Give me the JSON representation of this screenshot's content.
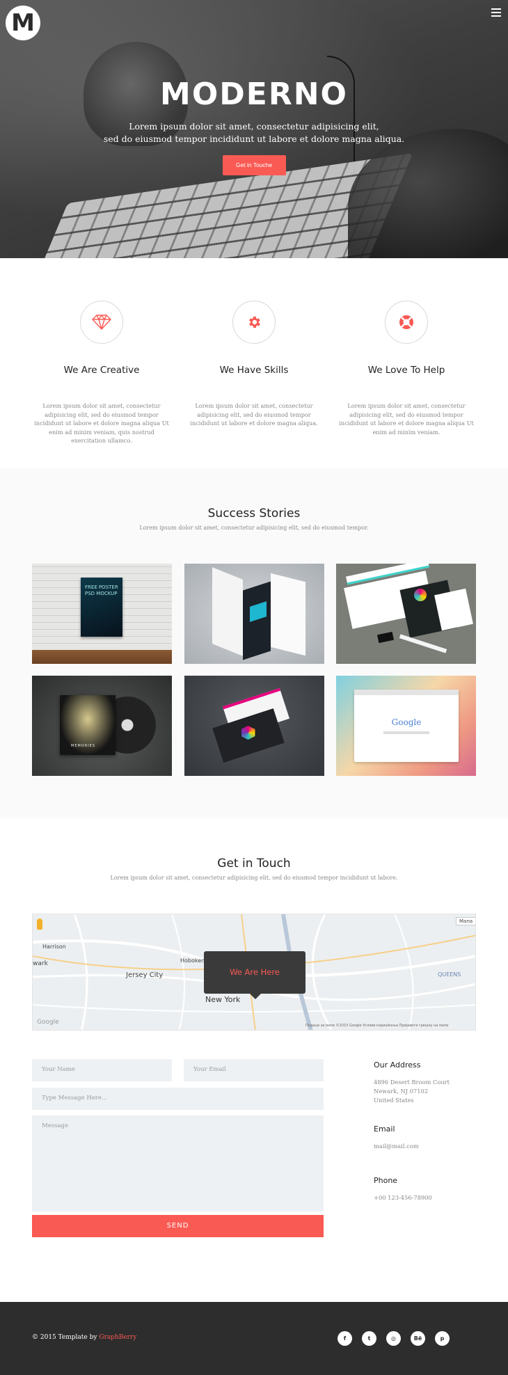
{
  "brand": {
    "logo_letter": "M"
  },
  "hero": {
    "title": "MODERNO",
    "subtitle_line1": "Lorem ipsum dolor sit amet, consectetur adipisicing elit,",
    "subtitle_line2": "sed do eiusmod tempor incididunt ut labore et dolore magna aliqua.",
    "cta_label": "Get in Touche"
  },
  "features": [
    {
      "icon": "diamond-icon",
      "title": "We Are Creative",
      "text": "Lorem ipsum dolor sit amet, consectetur adipisicing elit, sed do eiusmod tempor incididunt ut labore et dolore magna aliqua Ut enim ad minim veniam, quis nostrud exercitation ullamco."
    },
    {
      "icon": "gear-icon",
      "title": "We Have Skills",
      "text": "Lorem ipsum dolor sit amet, consectetur adipisicing elit, sed do eiusmod tempor incididunt ut labore et dolore magna aliqua."
    },
    {
      "icon": "lifebuoy-icon",
      "title": "We Love To Help",
      "text": "Lorem ipsum dolor sit amet, consectetur adipisicing elit, sed do eiusmod tempor incididunt ut labore et dolore magna aliqua Ut enim ad minim veniam."
    }
  ],
  "success": {
    "title": "Success Stories",
    "subtitle": "Lorem ipsum dolor sit amet, consectetur adipisicing elit, sed do eiusmod tempor.",
    "poster_text": "FREE POSTER PSD MOCKUP",
    "cd_text": "MEMORIES",
    "browser_text": "Google"
  },
  "contact": {
    "title": "Get in Touch",
    "subtitle": "Lorem ipsum dolor sit amet, consectetur adipisicing elit, sed do eiusmod tempor incididunt ut labore.",
    "map": {
      "bubble": "We Are Here",
      "city_newyork": "New York",
      "city_jersey": "Jersey City",
      "city_hoboken": "Hoboken",
      "city_queens": "QUEENS",
      "city_harrison": "Harrison",
      "city_newark": "wark",
      "map_button": "Мапа",
      "attribution": "Подаци за мапе ©2015 Google    Услови коришћења    Пријавите грешку на мапи",
      "google": "Google"
    },
    "form": {
      "name_placeholder": "Your Name",
      "email_placeholder": "Your Email",
      "subject_placeholder": "Type Message Here...",
      "message_placeholder": "Message",
      "send_label": "SEND"
    },
    "address": {
      "heading": "Our Address",
      "line1": "4896 Desert Broom Court",
      "line2": "Newark, NJ 07102",
      "line3": "United States"
    },
    "email": {
      "heading": "Email",
      "value": "mail@mail.com"
    },
    "phone": {
      "heading": "Phone",
      "value": "+00 123-456-78900"
    }
  },
  "footer": {
    "copyright_prefix": "© 2015 Template by",
    "author": "GraphBerry",
    "socials": [
      {
        "icon": "facebook-icon",
        "glyph": "f"
      },
      {
        "icon": "twitter-icon",
        "glyph": "t"
      },
      {
        "icon": "dribbble-icon",
        "glyph": "◎"
      },
      {
        "icon": "behance-icon",
        "glyph": "Bē"
      },
      {
        "icon": "pinterest-icon",
        "glyph": "p"
      }
    ]
  },
  "colors": {
    "accent": "#fa5a54",
    "footer_bg": "#2d2d2d",
    "field_bg": "#eef1f4"
  }
}
